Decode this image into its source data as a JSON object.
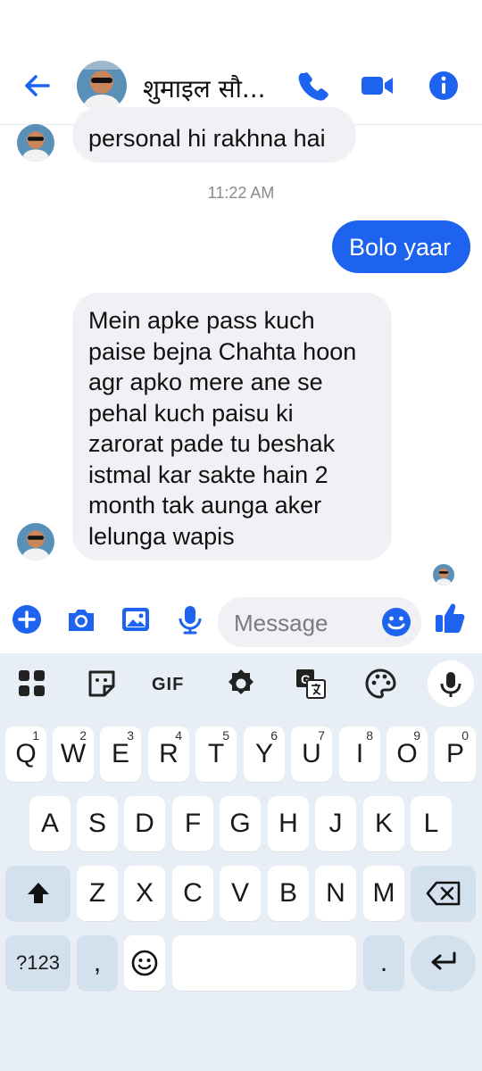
{
  "header": {
    "contact_name": "शुमाइल सौ...",
    "icons": [
      "back-arrow-icon",
      "phone-icon",
      "video-camera-icon",
      "info-icon"
    ]
  },
  "chat": {
    "partial_message": "personal hi rakhna hai",
    "timestamp": "11:22 AM",
    "outgoing_message": "Bolo yaar",
    "incoming_lines": [
      "Mein apke pass kuch",
      "paise bejna Chahta hoon",
      "agr apko mere ane se",
      "pehal kuch paisu ki",
      "zarorat pade tu beshak",
      "istmal kar sakte hain 2",
      "month tak aunga aker",
      "lelunga wapis"
    ]
  },
  "composer": {
    "placeholder": "Message",
    "icons": [
      "add-icon",
      "camera-icon",
      "gallery-icon",
      "microphone-icon",
      "emoji-icon",
      "thumbs-up-icon"
    ]
  },
  "keyboard": {
    "toolbar": {
      "gif_label": "GIF",
      "icons": [
        "apps-grid-icon",
        "sticker-icon",
        "gif-icon",
        "settings-icon",
        "translate-icon",
        "theme-palette-icon",
        "voice-input-icon"
      ]
    },
    "row1": [
      "Q",
      "W",
      "E",
      "R",
      "T",
      "Y",
      "U",
      "I",
      "O",
      "P"
    ],
    "row1_hints": [
      "1",
      "2",
      "3",
      "4",
      "5",
      "6",
      "7",
      "8",
      "9",
      "0"
    ],
    "row2": [
      "A",
      "S",
      "D",
      "F",
      "G",
      "H",
      "J",
      "K",
      "L"
    ],
    "row3": [
      "Z",
      "X",
      "C",
      "V",
      "B",
      "N",
      "M"
    ],
    "symbols_label": "?123",
    "comma_label": ",",
    "period_label": "."
  },
  "colors": {
    "accent": "#1e62f0",
    "bubble_incoming": "#f0f0f5",
    "keyboard_bg": "#e8eef6",
    "special_key": "#d3e1ef"
  }
}
